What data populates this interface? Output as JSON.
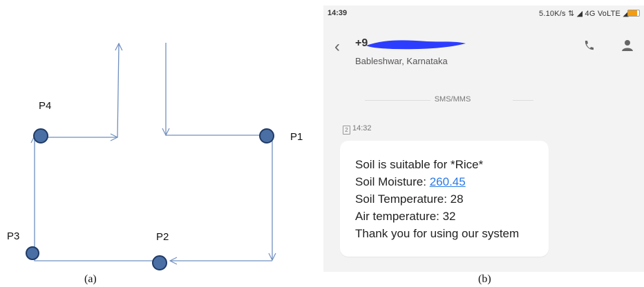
{
  "diagram": {
    "nodes": [
      {
        "id": "P1",
        "label": "P1"
      },
      {
        "id": "P2",
        "label": "P2"
      },
      {
        "id": "P3",
        "label": "P3"
      },
      {
        "id": "P4",
        "label": "P4"
      }
    ],
    "caption": "(a)",
    "colors": {
      "node_fill": "#4a6fa5",
      "node_stroke": "#1f3a66",
      "arrow": "#6f8fbf"
    }
  },
  "phone": {
    "status": {
      "time": "14:39",
      "right": "5.10K/s ⇅ ◢ 4G VoLTE ◢",
      "battery_pct": "54"
    },
    "header": {
      "contact": "+9",
      "location": "Bableshwar, Karnataka",
      "icons": [
        "back-icon",
        "call-icon",
        "person-icon"
      ]
    },
    "divider": "SMS/MMS",
    "message": {
      "sim": "2",
      "time": "14:32",
      "line1": "Soil is suitable for *Rice*",
      "moisture_label": "Soil Moisture: ",
      "moisture_value": "260.45",
      "line3": "Soil Temperature: 28",
      "line4": "Air temperature: 32",
      "line5": "Thank you for using our system"
    },
    "colors": {
      "redaction": "#2d3dff",
      "link": "#2a7ae2",
      "background": "#f3f3f3"
    }
  },
  "caption_b": "(b)"
}
